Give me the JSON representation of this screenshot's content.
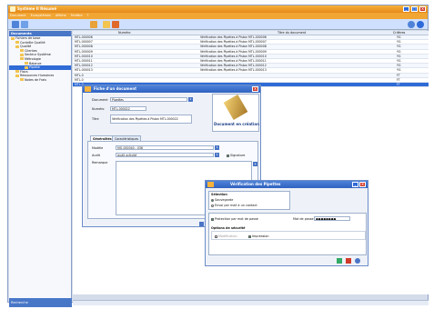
{
  "app": {
    "title": "Système II Résumé",
    "menu": [
      "Document",
      "Ecosystèmes",
      "Affiche",
      "Fenêtre",
      "?"
    ]
  },
  "sidebar": {
    "header": "Documents",
    "tree": [
      {
        "label": "Fichiers de base",
        "level": 0
      },
      {
        "label": "Contrôle Qualité",
        "level": 1
      },
      {
        "label": "Qualité",
        "level": 1
      },
      {
        "label": "Clientes",
        "level": 2
      },
      {
        "label": "Secteur Système",
        "level": 2
      },
      {
        "label": "Métrologie",
        "level": 2
      },
      {
        "label": "Balance",
        "level": 3
      },
      {
        "label": "Pipette",
        "level": 3,
        "selected": true
      },
      {
        "label": "Flacs",
        "level": 1
      },
      {
        "label": "Ressources Humaines",
        "level": 1
      },
      {
        "label": "Notes de Frais",
        "level": 2
      }
    ],
    "footer": "Recherche"
  },
  "grid": {
    "columns": [
      "Numéro",
      "Titre du document",
      "Critères"
    ],
    "rows": [
      {
        "num": "MTL-000006",
        "title": "Vérification des Pipettes à Piston MTL-000006",
        "crit": "YG"
      },
      {
        "num": "MTL-000007",
        "title": "Vérification des Pipettes à Piston MTL-000007",
        "crit": "YG"
      },
      {
        "num": "MTL-000008",
        "title": "Vérification des Pipettes à Piston MTL-000008",
        "crit": "YG"
      },
      {
        "num": "MTL-000009",
        "title": "Vérification des Pipettes à Piston MTL-000009",
        "crit": "YG"
      },
      {
        "num": "MTL-000010",
        "title": "Vérification des Pipettes à Piston MTL-000010",
        "crit": "YG"
      },
      {
        "num": "MTL-000011",
        "title": "Vérification des Pipettes à Piston MTL-000011",
        "crit": "YG"
      },
      {
        "num": "MTL-000012",
        "title": "Vérification des Pipettes à Piston MTL-000012",
        "crit": "YG"
      },
      {
        "num": "MTL-000013",
        "title": "Vérification des Pipettes à Piston MTL-000013",
        "crit": "YG"
      },
      {
        "num": "MTL-0",
        "title": "",
        "crit": "FT"
      },
      {
        "num": "MTL-0",
        "title": "",
        "crit": "FT"
      },
      {
        "num": "MTL-0",
        "title": "",
        "crit": "FT"
      }
    ]
  },
  "doc_dialog": {
    "title": "Fiche d'un document",
    "document_label": "Document",
    "document_value": "Pipettes",
    "numero_label": "Numéro",
    "numero_value": "MTL-000022",
    "titre_label": "Titre",
    "titre_value": "Vérification des Pipettes à Piston MTL-000022",
    "button": "Document en création",
    "tabs": [
      "Généralités",
      "Caractéristiques"
    ],
    "modele_label": "Modèle",
    "modele_value": "MO-000040 - 036",
    "audit_label": "Audit",
    "audit_value": "Audit activité",
    "signature_label": "Signature",
    "remarque_label": "Remarque"
  },
  "verif_dialog": {
    "title": "Vérification des Pipettes",
    "selection_label": "Sélection",
    "opt1": "Sauvegarde",
    "opt2": "Envoi par mail à un contact",
    "protect_label": "Protection par mot de passe",
    "password_label": "Mot de passe",
    "password_value": "●●●●●●●●",
    "security_label": "Options de sécurité",
    "modif_label": "Modification",
    "print_label": "Impression"
  },
  "colors": {
    "accent": "#f1a533",
    "selection": "#2f6bd6"
  }
}
